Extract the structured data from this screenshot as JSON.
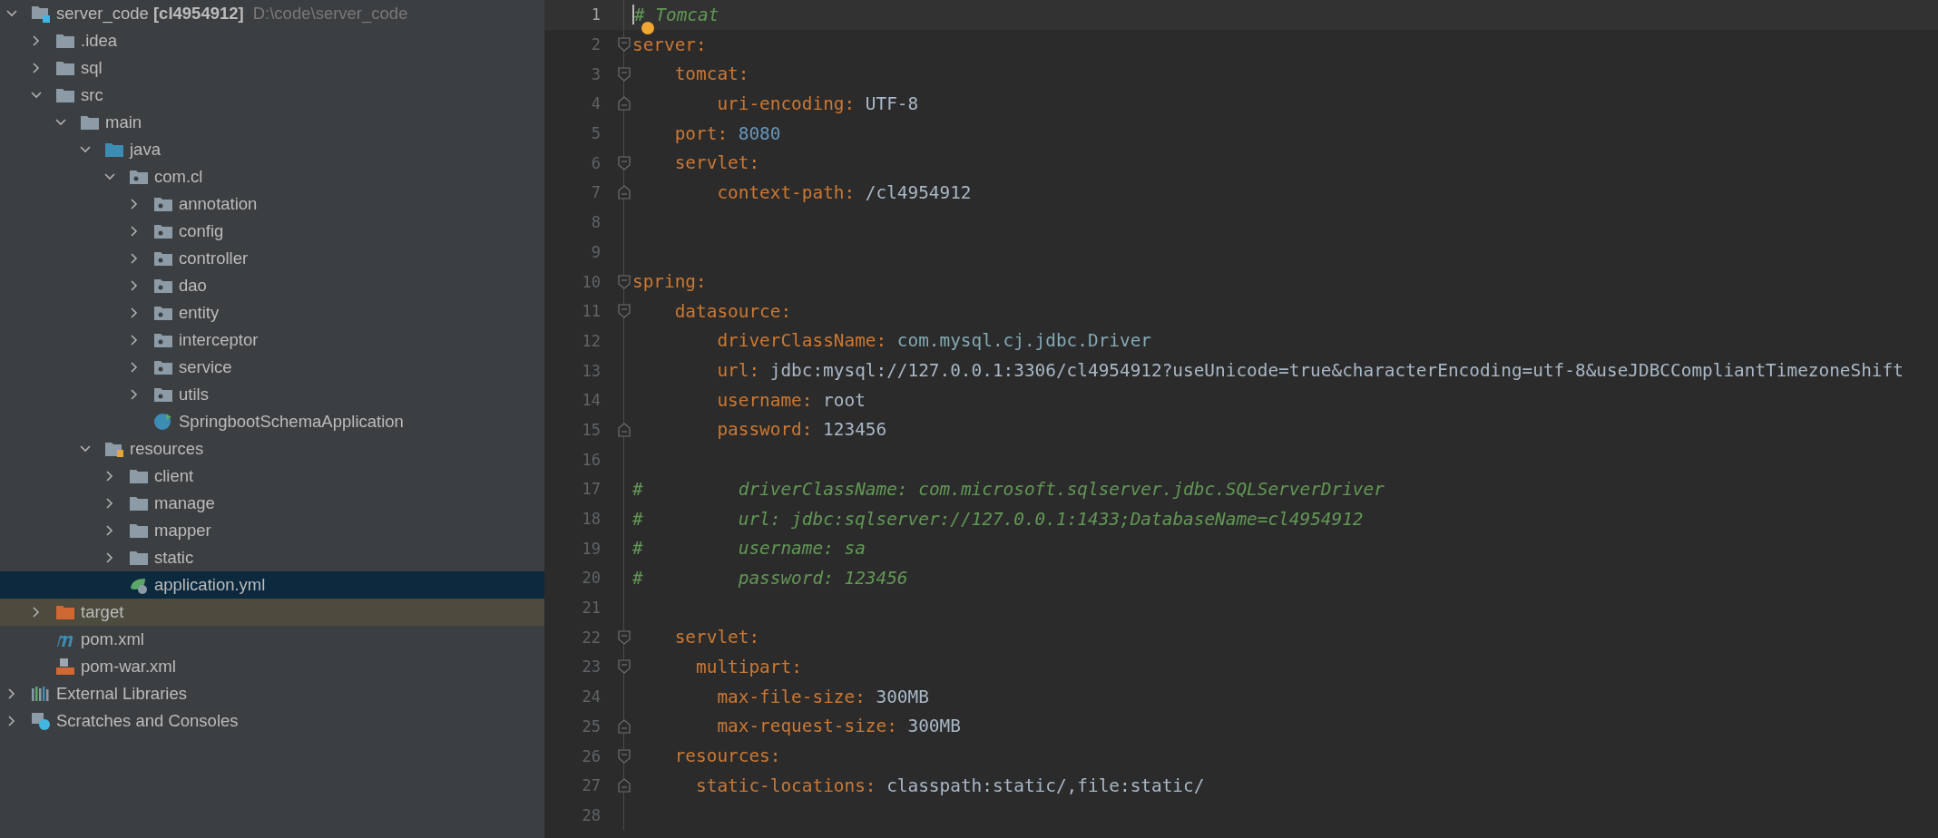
{
  "project_tree": {
    "items": [
      {
        "label": "server_code **[cl4954912]**",
        "path": "D:\\code\\server_code",
        "kind": "module",
        "expanded": true,
        "selected": false,
        "children": [
          {
            "label": ".idea",
            "kind": "folder",
            "expanded": false,
            "selected": false
          },
          {
            "label": "sql",
            "kind": "folder",
            "expanded": false,
            "selected": false
          },
          {
            "label": "src",
            "kind": "folder",
            "expanded": true,
            "selected": false,
            "children": [
              {
                "label": "main",
                "kind": "folder",
                "expanded": true,
                "selected": false,
                "children": [
                  {
                    "label": "java",
                    "kind": "source",
                    "expanded": true,
                    "selected": false,
                    "children": [
                      {
                        "label": "com.cl",
                        "kind": "package",
                        "expanded": true,
                        "selected": false,
                        "children": [
                          {
                            "label": "annotation",
                            "kind": "package",
                            "expanded": false,
                            "selected": false
                          },
                          {
                            "label": "config",
                            "kind": "package",
                            "expanded": false,
                            "selected": false
                          },
                          {
                            "label": "controller",
                            "kind": "package",
                            "expanded": false,
                            "selected": false
                          },
                          {
                            "label": "dao",
                            "kind": "package",
                            "expanded": false,
                            "selected": false
                          },
                          {
                            "label": "entity",
                            "kind": "package",
                            "expanded": false,
                            "selected": false
                          },
                          {
                            "label": "interceptor",
                            "kind": "package",
                            "expanded": false,
                            "selected": false
                          },
                          {
                            "label": "service",
                            "kind": "package",
                            "expanded": false,
                            "selected": false
                          },
                          {
                            "label": "utils",
                            "kind": "package",
                            "expanded": false,
                            "selected": false
                          },
                          {
                            "label": "SpringbootSchemaApplication",
                            "kind": "class",
                            "selected": false
                          }
                        ]
                      }
                    ]
                  },
                  {
                    "label": "resources",
                    "kind": "resources",
                    "expanded": true,
                    "selected": false,
                    "children": [
                      {
                        "label": "client",
                        "kind": "folder",
                        "expanded": false,
                        "selected": false
                      },
                      {
                        "label": "manage",
                        "kind": "folder",
                        "expanded": false,
                        "selected": false
                      },
                      {
                        "label": "mapper",
                        "kind": "folder",
                        "expanded": false,
                        "selected": false
                      },
                      {
                        "label": "static",
                        "kind": "folder",
                        "expanded": false,
                        "selected": false
                      },
                      {
                        "label": "application.yml",
                        "kind": "config",
                        "selected": true
                      }
                    ]
                  }
                ]
              }
            ]
          },
          {
            "label": "target",
            "kind": "excluded",
            "expanded": false,
            "selected": false
          },
          {
            "label": "pom.xml",
            "kind": "maven",
            "selected": false
          },
          {
            "label": "pom-war.xml",
            "kind": "xml",
            "selected": false
          }
        ]
      },
      {
        "label": "External Libraries",
        "kind": "libraries",
        "expanded": false,
        "selected": false
      },
      {
        "label": "Scratches and Consoles",
        "kind": "scratches",
        "expanded": false,
        "selected": false
      }
    ]
  },
  "editor": {
    "lines": [
      {
        "number": "1",
        "current": true,
        "fold_start": false,
        "fold_end": false,
        "tokens": [
          {
            "kind": "comment",
            "text": "# Tomcat"
          }
        ]
      },
      {
        "number": "2",
        "current": false,
        "fold_start": true,
        "fold_end": false,
        "tokens": [
          {
            "kind": "key",
            "text": "server"
          },
          {
            "kind": "colon",
            "text": ":"
          }
        ]
      },
      {
        "number": "3",
        "current": false,
        "fold_start": true,
        "fold_end": false,
        "tokens": [
          {
            "kind": "key",
            "text": "    tomcat"
          },
          {
            "kind": "colon",
            "text": ":"
          }
        ]
      },
      {
        "number": "4",
        "current": false,
        "fold_start": false,
        "fold_end": true,
        "tokens": [
          {
            "kind": "key",
            "text": "        uri-encoding"
          },
          {
            "kind": "colon",
            "text": ":"
          },
          {
            "kind": "string",
            "text": "UTF-8"
          }
        ]
      },
      {
        "number": "5",
        "current": false,
        "fold_start": false,
        "fold_end": false,
        "tokens": [
          {
            "kind": "key",
            "text": "    port"
          },
          {
            "kind": "colon",
            "text": ":"
          },
          {
            "kind": "number",
            "text": "8080"
          }
        ]
      },
      {
        "number": "6",
        "current": false,
        "fold_start": true,
        "fold_end": false,
        "tokens": [
          {
            "kind": "key",
            "text": "    servlet"
          },
          {
            "kind": "colon",
            "text": ":"
          }
        ]
      },
      {
        "number": "7",
        "current": false,
        "fold_start": false,
        "fold_end": true,
        "tokens": [
          {
            "kind": "key",
            "text": "        context-path"
          },
          {
            "kind": "colon",
            "text": ":"
          },
          {
            "kind": "string",
            "text": "/cl4954912"
          }
        ]
      },
      {
        "number": "8",
        "current": false,
        "fold_start": false,
        "fold_end": false
      },
      {
        "number": "9",
        "current": false,
        "fold_start": false,
        "fold_end": false
      },
      {
        "number": "10",
        "current": false,
        "fold_start": true,
        "fold_end": false,
        "tokens": [
          {
            "kind": "key",
            "text": "spring"
          },
          {
            "kind": "colon",
            "text": ":"
          }
        ]
      },
      {
        "number": "11",
        "current": false,
        "fold_start": true,
        "fold_end": false,
        "tokens": [
          {
            "kind": "key",
            "text": "    datasource"
          },
          {
            "kind": "colon",
            "text": ":"
          }
        ]
      },
      {
        "number": "12",
        "current": false,
        "fold_start": false,
        "fold_end": false,
        "tokens": [
          {
            "kind": "key",
            "text": "        driverClassName"
          },
          {
            "kind": "colon",
            "text": ":"
          },
          {
            "kind": "class",
            "text": "com.mysql.cj.jdbc.Driver"
          }
        ]
      },
      {
        "number": "13",
        "current": false,
        "fold_start": false,
        "fold_end": false,
        "tokens": [
          {
            "kind": "key",
            "text": "        url"
          },
          {
            "kind": "colon",
            "text": ":"
          },
          {
            "kind": "string",
            "text": "jdbc:mysql://127.0.0.1:3306/cl4954912?useUnicode=true&characterEncoding=utf-8&useJDBCCompliantTimezoneShift"
          }
        ]
      },
      {
        "number": "14",
        "current": false,
        "fold_start": false,
        "fold_end": false,
        "tokens": [
          {
            "kind": "key",
            "text": "        username"
          },
          {
            "kind": "colon",
            "text": ":"
          },
          {
            "kind": "string",
            "text": "root"
          }
        ]
      },
      {
        "number": "15",
        "current": false,
        "fold_start": false,
        "fold_end": true,
        "tokens": [
          {
            "kind": "key",
            "text": "        password"
          },
          {
            "kind": "colon",
            "text": ":"
          },
          {
            "kind": "string",
            "text": "123456"
          }
        ]
      },
      {
        "number": "16",
        "current": false,
        "fold_start": false,
        "fold_end": false
      },
      {
        "number": "17",
        "current": false,
        "fold_start": false,
        "fold_end": false,
        "tokens": [
          {
            "kind": "comment",
            "text": "#         driverClassName: com.microsoft.sqlserver.jdbc.SQLServerDriver"
          }
        ]
      },
      {
        "number": "18",
        "current": false,
        "fold_start": false,
        "fold_end": false,
        "tokens": [
          {
            "kind": "comment",
            "text": "#         url: jdbc:sqlserver://127.0.0.1:1433;DatabaseName=cl4954912"
          }
        ]
      },
      {
        "number": "19",
        "current": false,
        "fold_start": false,
        "fold_end": false,
        "tokens": [
          {
            "kind": "comment",
            "text": "#         username: sa"
          }
        ]
      },
      {
        "number": "20",
        "current": false,
        "fold_start": false,
        "fold_end": false,
        "tokens": [
          {
            "kind": "comment",
            "text": "#         password: 123456"
          }
        ]
      },
      {
        "number": "21",
        "current": false,
        "fold_start": false,
        "fold_end": false
      },
      {
        "number": "22",
        "current": false,
        "fold_start": true,
        "fold_end": false,
        "tokens": [
          {
            "kind": "key",
            "text": "    servlet"
          },
          {
            "kind": "colon",
            "text": ":"
          }
        ]
      },
      {
        "number": "23",
        "current": false,
        "fold_start": true,
        "fold_end": false,
        "tokens": [
          {
            "kind": "key",
            "text": "      multipart"
          },
          {
            "kind": "colon",
            "text": ":"
          }
        ]
      },
      {
        "number": "24",
        "current": false,
        "fold_start": false,
        "fold_end": false,
        "tokens": [
          {
            "kind": "key",
            "text": "        max-file-size"
          },
          {
            "kind": "colon",
            "text": ":"
          },
          {
            "kind": "string",
            "text": "300MB"
          }
        ]
      },
      {
        "number": "25",
        "current": false,
        "fold_start": false,
        "fold_end": true,
        "tokens": [
          {
            "kind": "key",
            "text": "        max-request-size"
          },
          {
            "kind": "colon",
            "text": ":"
          },
          {
            "kind": "string",
            "text": "300MB"
          }
        ]
      },
      {
        "number": "26",
        "current": false,
        "fold_start": true,
        "fold_end": false,
        "tokens": [
          {
            "kind": "key",
            "text": "    resources"
          },
          {
            "kind": "colon",
            "text": ":"
          }
        ]
      },
      {
        "number": "27",
        "current": false,
        "fold_start": false,
        "fold_end": true,
        "tokens": [
          {
            "kind": "key",
            "text": "      static-locations"
          },
          {
            "kind": "colon",
            "text": ":"
          },
          {
            "kind": "string",
            "text": "classpath:static/,file:static/"
          }
        ]
      },
      {
        "number": "28",
        "current": false,
        "fold_start": false,
        "fold_end": false
      }
    ]
  }
}
